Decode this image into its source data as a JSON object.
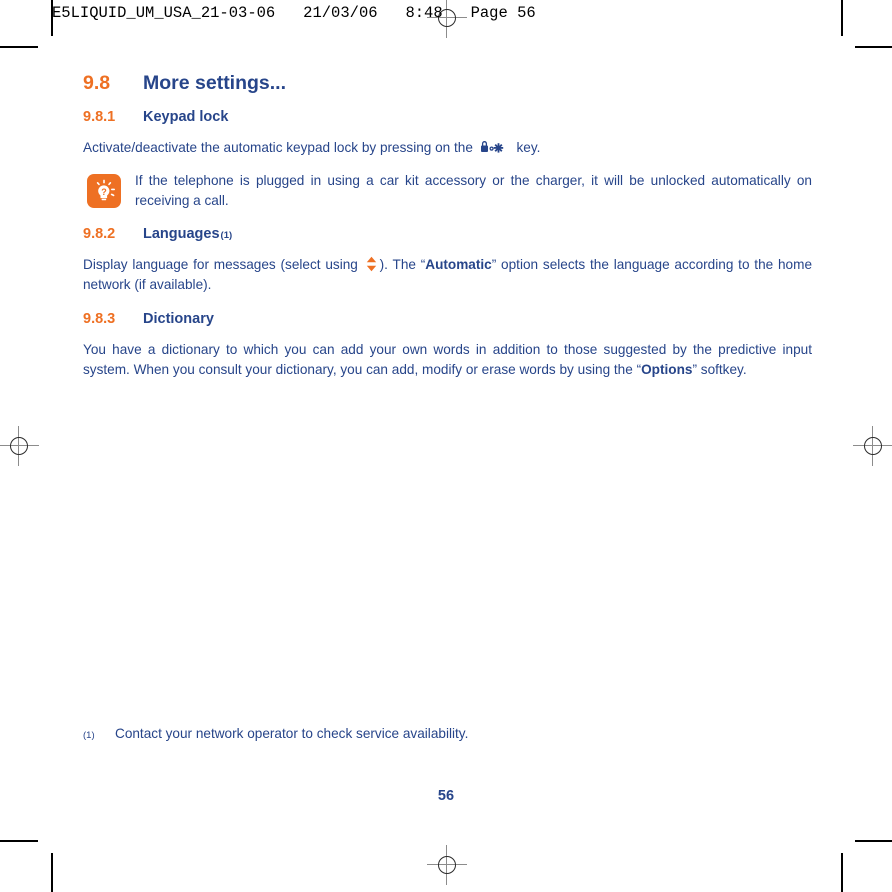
{
  "print_marks": {
    "header_stamp": "E5LIQUID_UM_USA_21-03-06   21/03/06   8:48   Page 56"
  },
  "document": {
    "section": {
      "number": "9.8",
      "title": "More settings..."
    },
    "subsections": [
      {
        "number": "9.8.1",
        "title": "Keypad lock",
        "footnote_marker": "",
        "paragraph_before": "Activate/deactivate the automatic keypad lock by pressing on the ",
        "paragraph_after": " key.",
        "inline_icon": "keypad-lock-key-icon"
      },
      {
        "number": "9.8.2",
        "title": "Languages",
        "footnote_marker": "(1)",
        "paragraph_part1": "Display language for messages (select using ",
        "inline_icon": "up-down-navigation-key-icon",
        "paragraph_part2": "). The “",
        "bold_term": "Automatic",
        "paragraph_part3": "” option selects the language according to the home network (if available)."
      },
      {
        "number": "9.8.3",
        "title": "Dictionary",
        "footnote_marker": "",
        "paragraph_part1": "You have a dictionary to which you can add your own words in addition to those suggested by the predictive input system. When you consult your dictionary, you can add, modify or erase words by using the “",
        "bold_term": "Options",
        "paragraph_part2": "” softkey."
      }
    ],
    "note": {
      "icon": "lightbulb-tip-icon",
      "text": "If the telephone is plugged in using a car kit accessory or the charger, it will be unlocked automatically on receiving a call."
    },
    "footnote": {
      "marker": "(1)",
      "text": "Contact your network operator to check service availability."
    },
    "page_number": "56"
  },
  "colors": {
    "heading_blue": "#27458A",
    "accent_orange": "#EE7023",
    "body_blue": "#27458A",
    "paper": "#FFFFFF"
  }
}
